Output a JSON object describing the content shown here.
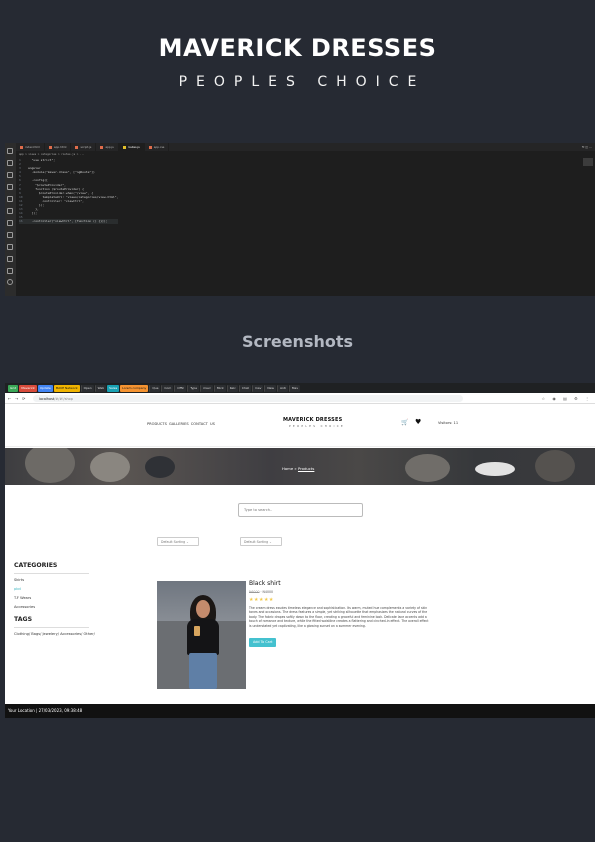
{
  "header": {
    "title": "MAVERICK  DRESSES",
    "subtitle": "PEOPLES CHOICE"
  },
  "section_title": "Screenshots",
  "vscode": {
    "tabs": [
      "index.html",
      "app.html",
      "script.js",
      "app.js",
      "routes.js",
      "app.css"
    ],
    "breadcrumb": "app > views > categories > routes.js > ...",
    "lines": [
      "  \"use strict\";",
      "",
      "angular",
      "  .module(\"maver.dress\", [\"ngRoute\"])",
      "",
      "  .config([",
      "    \"$routeProvider\",",
      "    function ($routeProvider) {",
      "      $routeProvider.when(\"/view\", {",
      "        templateUrl: \"views/categories/view.html\",",
      "        controller: \"viewCtrl\",",
      "      });",
      "    },",
      "  ]);",
      "",
      "  .controller(\"viewCtrl\", [function () {}]);"
    ]
  },
  "browser": {
    "tabs": [
      {
        "label": "Grid",
        "style": "g"
      },
      {
        "label": "Maverick",
        "style": "r"
      },
      {
        "label": "Update",
        "style": "b"
      },
      {
        "label": "MAVE Network",
        "style": "y"
      },
      {
        "label": "Open",
        "style": "d"
      },
      {
        "label": "Web",
        "style": "d"
      },
      {
        "label": "Sales",
        "style": "c"
      },
      {
        "label": "Lorem company",
        "style": "o"
      },
      {
        "label": "Que",
        "style": "d"
      },
      {
        "label": "Com",
        "style": "d"
      },
      {
        "label": "Offic",
        "style": "d"
      },
      {
        "label": "Type",
        "style": "d"
      },
      {
        "label": "mavr",
        "style": "d"
      },
      {
        "label": "Mick",
        "style": "d"
      },
      {
        "label": "Kelc",
        "style": "d"
      },
      {
        "label": "Chat",
        "style": "d"
      },
      {
        "label": "mav",
        "style": "d"
      },
      {
        "label": "New",
        "style": "d"
      },
      {
        "label": "Anti",
        "style": "d"
      },
      {
        "label": "Mav",
        "style": "d"
      }
    ],
    "url_host": "localhost",
    "url_path": "/#/#!/shop"
  },
  "site": {
    "nav": "PRODUCTS  GALLERIES  CONTACT US",
    "logo": "MAVERICK DRESSES",
    "logo_sub": "PEOPLES CHOICE",
    "visitors": "Visitors: 11",
    "breadcrumb_home": "Home »",
    "breadcrumb_current": "Products",
    "search_placeholder": "Type to search..",
    "sort1": "Default Sorting",
    "sort2": "Default Sorting",
    "categories_title": "CATEGORIES",
    "categories": [
      "Skirts",
      "pbd",
      "T.F Wears",
      "Accessories"
    ],
    "active_category_index": 1,
    "tags_title": "TAGS",
    "tags": "Clothing/ Bags/ Jewelery/ Accessories/ Other/",
    "product": {
      "name": "Black shirt",
      "old_price": "N6000",
      "price": "N4000",
      "rating": 0,
      "desc": "The cream dress exudes timeless elegance and sophistication. Its warm, muted hue complements a variety of skin tones and occasions. The dress features a simple, yet striking silhouette that emphasizes the natural curves of the body. The fabric drapes softly down to the floor, creating a graceful and feminine look. Delicate lace accents add a touch of romance and texture, while the fitted waistline creates a flattering and cinched-in effect. The overall effect is understated yet captivating, like a glowing sunset on a summer evening.",
      "button": "Add To Cart"
    },
    "footer": "Your Location | 27/03/2023, 09:38:48"
  }
}
